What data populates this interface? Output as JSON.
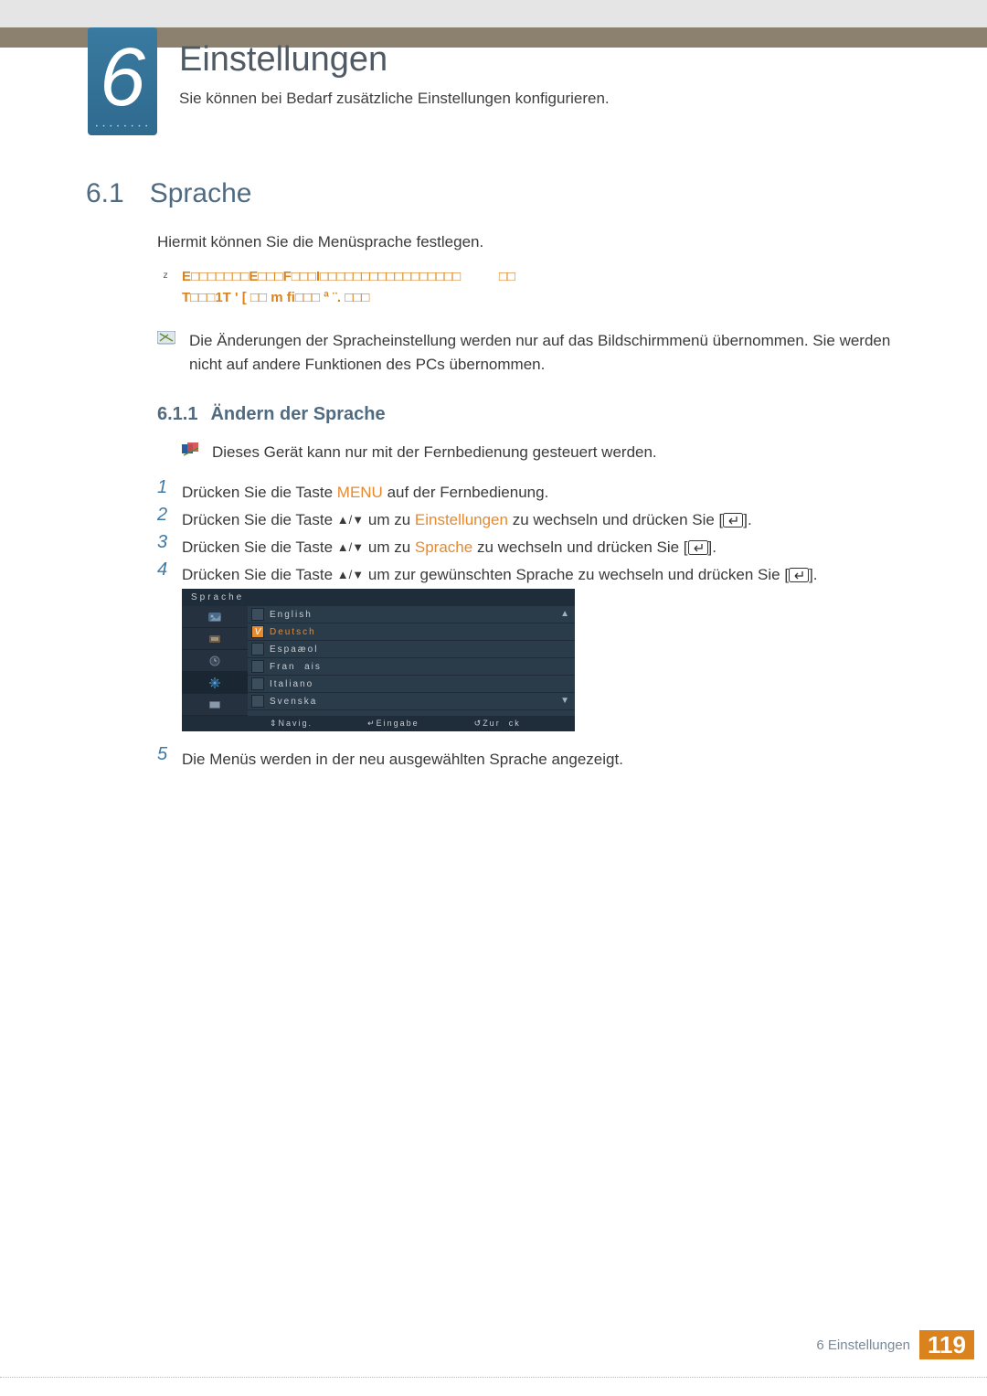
{
  "chapter": {
    "number": "6",
    "title": "Einstellungen",
    "subtitle": "Sie können bei Bedarf zusätzliche Einstellungen konfigurieren."
  },
  "section": {
    "number": "6.1",
    "title": "Sprache",
    "intro": "Hiermit können Sie die Menüsprache festlegen.",
    "warn_line1": "E□□□□□□□E□□□F□□□I□□□□□□□□□□□□□□□□□          □□",
    "warn_line2": "T□□□1T '   [  □□    m fi□□□ ª ¨.  □□□",
    "note": "Die Änderungen der Spracheinstellung werden nur auf das Bildschirmmenü übernommen. Sie werden nicht auf andere Funktionen des PCs übernommen."
  },
  "subsection": {
    "number": "6.1.1",
    "title": "Ändern der Sprache",
    "note": "Dieses Gerät kann nur mit der Fernbedienung gesteuert werden."
  },
  "steps": {
    "s1_a": "Drücken Sie die Taste ",
    "s1_menu": "MENU",
    "s1_b": " auf der Fernbedienung.",
    "s2_a": "Drücken Sie die Taste ",
    "s2_b": " um zu ",
    "s2_link": "Einstellungen",
    "s2_c": " zu wechseln und drücken Sie [",
    "s2_d": "].",
    "s3_a": "Drücken Sie die Taste ",
    "s3_b": " um zu ",
    "s3_link": "Sprache",
    "s3_c": " zu wechseln und drücken Sie [",
    "s3_d": "].",
    "s4_a": "Drücken Sie die Taste ",
    "s4_b": " um zur gewünschten Sprache zu wechseln und drücken Sie [",
    "s4_c": "].",
    "s5": "Die Menüs werden in der neu ausgewählten Sprache angezeigt."
  },
  "menu": {
    "title": "Sprache",
    "items": [
      "English",
      "Deutsch",
      "Espaæol",
      "Fran  ais",
      "Italiano",
      "Svenska"
    ],
    "selected_index": 1,
    "footer": {
      "nav": "Navig.",
      "enter": "Eingabe",
      "back": "Zur  ck"
    }
  },
  "footer": {
    "label": "6 Einstellungen",
    "page": "119"
  }
}
